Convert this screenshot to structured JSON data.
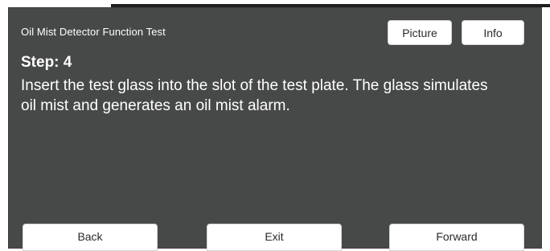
{
  "header": {
    "title": "Oil Mist Detector Function Test",
    "picture_label": "Picture",
    "info_label": "Info"
  },
  "step": {
    "label": "Step: 4",
    "instruction": "Insert the test glass into the slot of the test plate. The glass simulates oil mist and generates an oil mist alarm."
  },
  "footer": {
    "back_label": "Back",
    "exit_label": "Exit",
    "forward_label": "Forward"
  },
  "colors": {
    "panel_background": "#474948",
    "button_background": "#ffffff",
    "text": "#ffffff"
  }
}
